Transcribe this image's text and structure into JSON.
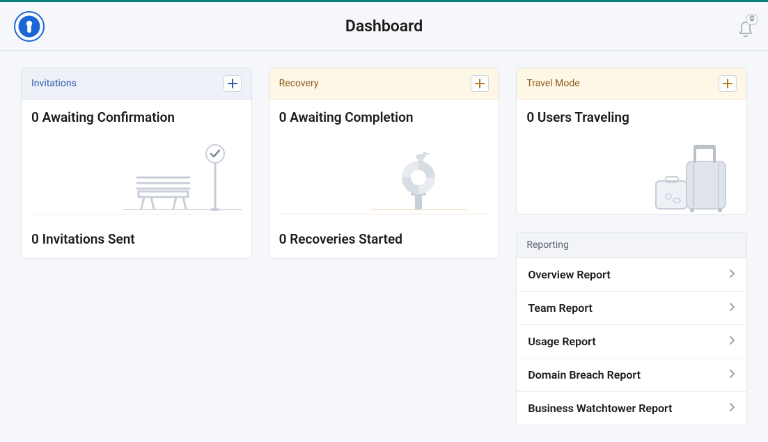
{
  "header": {
    "title": "Dashboard",
    "notifications_count": "0"
  },
  "cards": {
    "invitations": {
      "title": "Invitations",
      "top_stat": "0 Awaiting Confirmation",
      "bottom_stat": "0 Invitations Sent"
    },
    "recovery": {
      "title": "Recovery",
      "top_stat": "0 Awaiting Completion",
      "bottom_stat": "0 Recoveries Started"
    },
    "travel": {
      "title": "Travel Mode",
      "top_stat": "0 Users Traveling"
    }
  },
  "reporting": {
    "title": "Reporting",
    "items": [
      "Overview Report",
      "Team Report",
      "Usage Report",
      "Domain Breach Report",
      "Business Watchtower Report"
    ]
  },
  "colors": {
    "plus_blue": "#2a5db0",
    "plus_amber": "#b37a1f"
  }
}
